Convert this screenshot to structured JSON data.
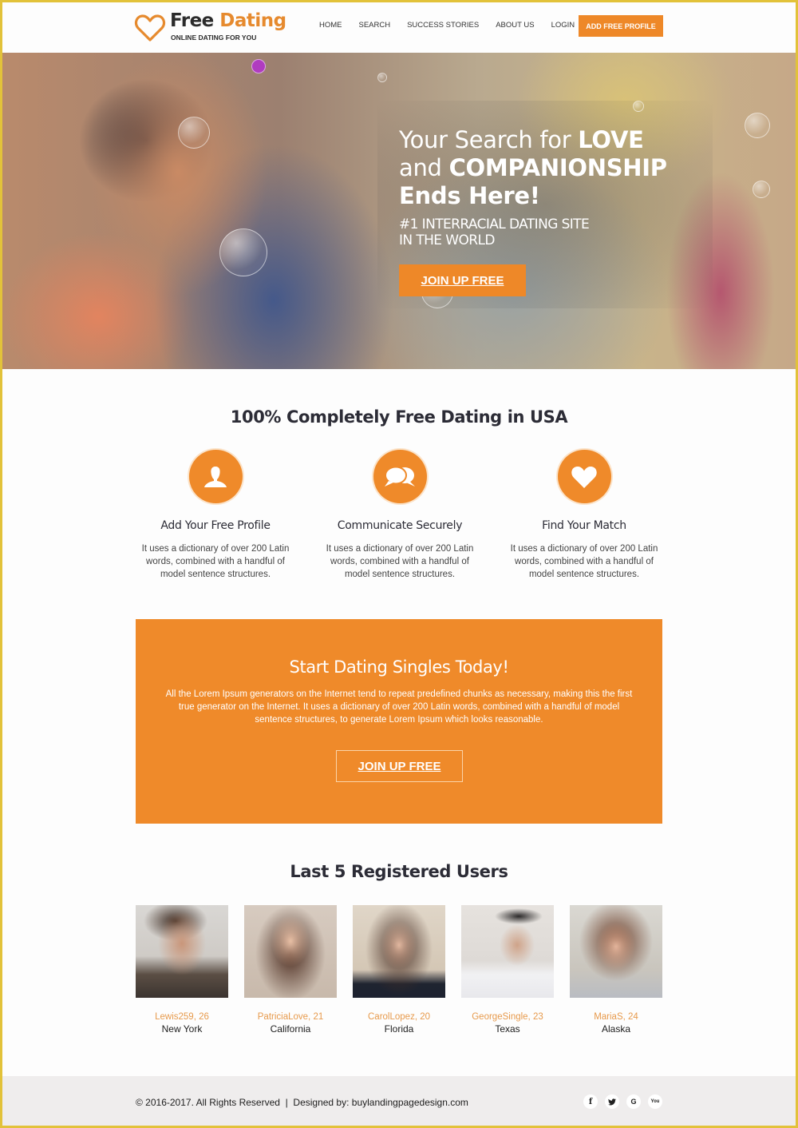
{
  "header": {
    "logo": {
      "title_dark": "Free ",
      "title_accent": "Dating",
      "tagline": "ONLINE DATING FOR YOU"
    },
    "nav": [
      {
        "label": "HOME"
      },
      {
        "label": "SEARCH"
      },
      {
        "label": "SUCCESS STORIES"
      },
      {
        "label": "ABOUT US"
      },
      {
        "label": "LOGIN"
      }
    ],
    "cta_label": "ADD FREE PROFILE"
  },
  "hero": {
    "title_line1_normal": "Your Search for ",
    "title_line1_bold": "LOVE",
    "title_line2_normal": "and ",
    "title_line2_bold": "COMPANIONSHIP",
    "title_line3": "Ends Here!",
    "subtitle_line1": "#1 INTERRACIAL DATING SITE",
    "subtitle_line2": "IN THE WORLD",
    "button_label": "JOIN UP FREE"
  },
  "features": {
    "title": "100% Completely Free Dating in USA",
    "items": [
      {
        "icon": "user-icon",
        "title": "Add Your Free Profile",
        "text": "It uses a dictionary of over 200 Latin words, combined with a handful of model sentence structures."
      },
      {
        "icon": "chat-bubbles-icon",
        "title": "Communicate Securely",
        "text": "It uses a dictionary of over 200 Latin words, combined with a handful of model sentence structures."
      },
      {
        "icon": "heart-icon",
        "title": "Find Your Match",
        "text": "It uses a dictionary of over 200 Latin words, combined with a handful of model sentence structures."
      }
    ]
  },
  "promo": {
    "title": "Start Dating Singles Today!",
    "text": "All the Lorem Ipsum generators on the Internet tend to repeat predefined chunks as necessary, making this the first true generator on the Internet. It uses a dictionary of over 200 Latin words, combined with a handful of model sentence structures, to generate Lorem Ipsum which looks reasonable.",
    "button_label": "JOIN UP FREE"
  },
  "users": {
    "title": "Last 5 Registered Users",
    "items": [
      {
        "name": "Lewis259, 26",
        "location": "New York"
      },
      {
        "name": "PatriciaLove, 21",
        "location": "California"
      },
      {
        "name": "CarolLopez, 20",
        "location": "Florida"
      },
      {
        "name": "GeorgeSingle, 23",
        "location": "Texas"
      },
      {
        "name": "MariaS, 24",
        "location": "Alaska"
      }
    ]
  },
  "footer": {
    "copyright": "© 2016-2017. All Rights Reserved  |  Designed by: buylandingpagedesign.com",
    "social": [
      {
        "icon": "facebook-icon",
        "glyph": "f"
      },
      {
        "icon": "twitter-icon",
        "glyph": "t"
      },
      {
        "icon": "google-plus-icon",
        "glyph": "G"
      },
      {
        "icon": "youtube-icon",
        "glyph": "You"
      }
    ]
  },
  "colors": {
    "accent": "#ef8a2a",
    "frame": "#e2c23a",
    "footer_bg": "#efeded",
    "username": "#e79a4c"
  }
}
